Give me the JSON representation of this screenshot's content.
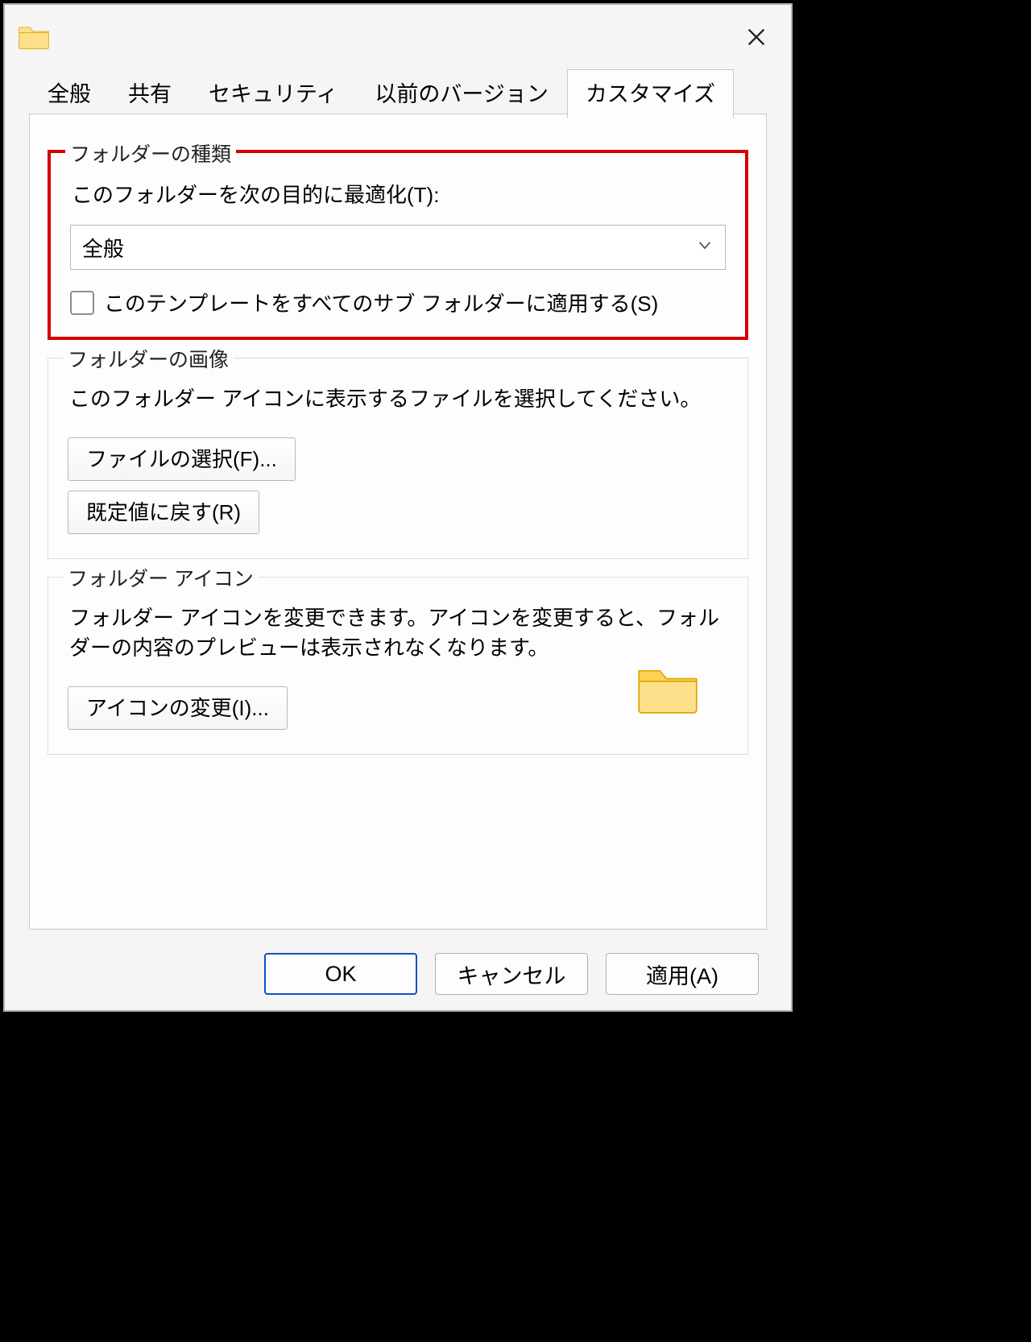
{
  "tabs": {
    "general": "全般",
    "share": "共有",
    "security": "セキュリティ",
    "versions": "以前のバージョン",
    "customize": "カスタマイズ",
    "active": "customize"
  },
  "group_folder_type": {
    "title": "フォルダーの種類",
    "optimize_for": "このフォルダーを次の目的に最適化(T):",
    "combo_value": "全般",
    "apply_sub": "このテンプレートをすべてのサブ フォルダーに適用する(S)",
    "apply_sub_checked": false
  },
  "group_folder_image": {
    "title": "フォルダーの画像",
    "desc": "このフォルダー アイコンに表示するファイルを選択してください。",
    "choose_file": "ファイルの選択(F)...",
    "restore": "既定値に戻す(R)"
  },
  "group_folder_icon": {
    "title": "フォルダー アイコン",
    "desc": "フォルダー アイコンを変更できます。アイコンを変更すると、フォルダーの内容のプレビューは表示されなくなります。",
    "change_icon": "アイコンの変更(I)..."
  },
  "footer": {
    "ok": "OK",
    "cancel": "キャンセル",
    "apply": "適用(A)"
  },
  "highlight_section": "group_folder_type"
}
